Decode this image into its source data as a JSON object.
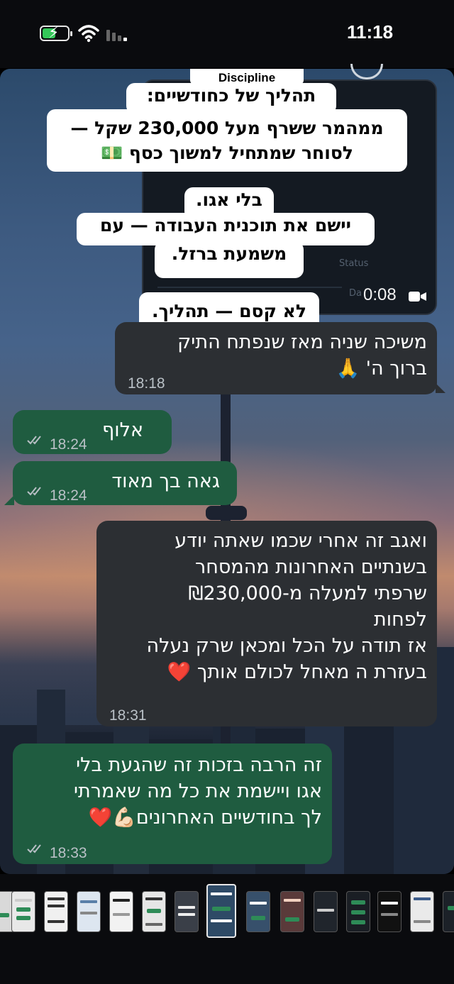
{
  "status_bar": {
    "time": "11:18",
    "battery_charging": true,
    "icons": [
      "battery-charging-icon",
      "wifi-icon",
      "cellular-signal-icon"
    ]
  },
  "story": {
    "header_label": "Discipline",
    "video_duration": "0:08",
    "caption_lines": [
      "תהליך של כחודשיים:",
      "ממהמר ששרף מעל 230,000 שקל —",
      "לסוחר שמתחיל למשוך כסף 💵",
      "בלי אגו.",
      "יישם את תוכנית העבודה — עם",
      "משמעת ברזל.",
      "לא קסם — תהליך."
    ],
    "video_labels": {
      "status": "Status",
      "date": "Da"
    }
  },
  "messages": [
    {
      "direction": "incoming",
      "lines": [
        "משיכה שניה מאז שנפתח התיק",
        "ברוך ה' 🙏"
      ],
      "time": "18:18"
    },
    {
      "direction": "outgoing",
      "lines": [
        "אלוף"
      ],
      "time": "18:24",
      "read": true
    },
    {
      "direction": "outgoing",
      "lines": [
        "גאה בך מאוד"
      ],
      "time": "18:24",
      "read": true
    },
    {
      "direction": "incoming",
      "lines": [
        "ואגב זה אחרי שכמו שאתה יודע",
        "בשנתיים האחרונות מהמסחר",
        "שרפתי למעלה מ-₪230,000",
        "לפחות",
        "אז תודה על הכל ומכאן שרק נעלה",
        "בעזרת ה מאחל לכולם אותך ❤️"
      ],
      "time": "18:31"
    },
    {
      "direction": "outgoing",
      "lines": [
        "זה הרבה בזכות זה שהגעת בלי",
        "אגו ויישמת את כל מה שאמרתי",
        "לך בחודשיים האחרונים💪🏻❤️"
      ],
      "time": "18:33",
      "read": true
    }
  ],
  "colors": {
    "incoming_bubble": "#2c2f33",
    "outgoing_bubble": "#1f5c40",
    "caption_bg": "#ffffff",
    "timestamp": "#b9c0c6",
    "heart": "#e3262e"
  },
  "thumbnail_bar": {
    "count": 15,
    "active_index": 7
  }
}
